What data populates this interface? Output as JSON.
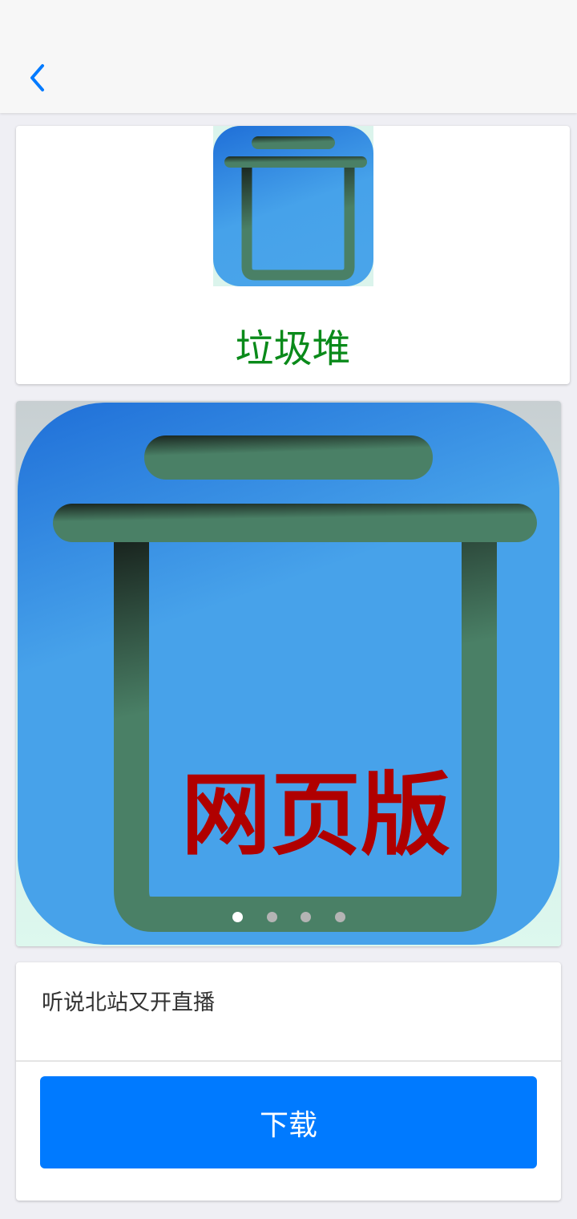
{
  "nav": {
    "back_icon": "chevron-left-icon"
  },
  "app": {
    "name": "垃圾堆",
    "icon": "trash-can-icon"
  },
  "carousel": {
    "slide_caption": "网页版",
    "total_slides": 4,
    "active_index": 0
  },
  "description": "听说北站又开直播",
  "download_label": "下载",
  "colors": {
    "accent": "#007aff",
    "app_name": "#0a8a1a",
    "caption_red": "#b00000",
    "icon_blue": "#2a83e4",
    "icon_green": "#4a8066"
  }
}
